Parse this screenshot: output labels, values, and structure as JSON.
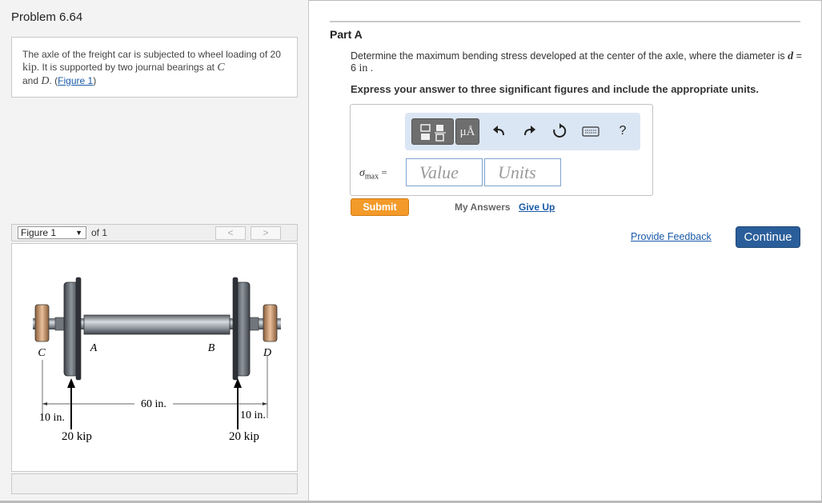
{
  "problem": {
    "title": "Problem 6.64",
    "text_1": "The axle of the freight car is subjected to wheel loading of 20 ",
    "unit_kip": "kip",
    "text_2": ". It is supported by two journal bearings at ",
    "point_c": "C",
    "text_3": "and ",
    "point_d": "D",
    "text_4": ". (",
    "figure_link": "Figure 1",
    "text_5": ")"
  },
  "figure": {
    "selector_label": "Figure 1",
    "of_label": "of 1",
    "prev": "<",
    "next": ">",
    "labels": {
      "A": "A",
      "B": "B",
      "C": "C",
      "D": "D",
      "dim_left": "10 in.",
      "dim_mid": "60 in.",
      "dim_right": "10 in.",
      "load_left": "20 kip",
      "load_right": "20 kip"
    }
  },
  "part": {
    "title": "Part A",
    "question_1": "Determine the maximum bending stress developed at the center of the axle, where the diameter is ",
    "d_var": "d",
    "question_2": " = 6 ",
    "d_unit": "in",
    "question_3": " .",
    "instruction": "Express your answer to three significant figures and include the appropriate units."
  },
  "toolbar": {
    "units_button": "μÅ",
    "icons": [
      "templates-icon",
      "units-icon",
      "undo-icon",
      "redo-icon",
      "reset-icon",
      "keyboard-icon",
      "help-icon"
    ],
    "help_label": "?"
  },
  "answer": {
    "sigma": "σ",
    "sigma_sub": "max",
    "equals": "=",
    "value_placeholder": "Value",
    "units_placeholder": "Units"
  },
  "actions": {
    "submit": "Submit",
    "my_answers": "My Answers",
    "give_up": "Give Up",
    "provide_feedback": "Provide Feedback",
    "continue": "Continue"
  },
  "colors": {
    "link": "#1a5aa8",
    "submit": "#f39a2a",
    "continue": "#2a5e9a",
    "toolbar_bg": "#dbe6f4"
  }
}
